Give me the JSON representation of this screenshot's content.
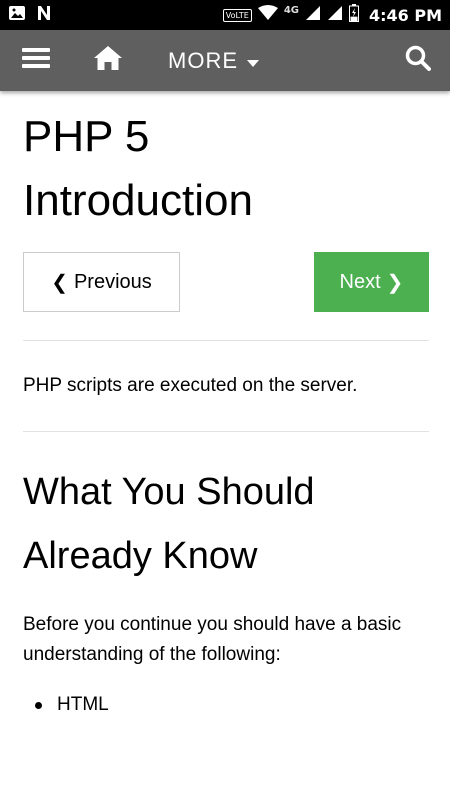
{
  "status_bar": {
    "volte": "VoLTE",
    "network": "4G",
    "battery_level": 0.3,
    "time": "4:46 PM"
  },
  "navbar": {
    "more_label": "MORE"
  },
  "content": {
    "title_line1": "PHP 5",
    "title_line2": "Introduction",
    "prev_label": "Previous",
    "next_label": "Next",
    "intro": "PHP scripts are executed on the server.",
    "section_title_line1": "What You Should",
    "section_title_line2": "Already Know",
    "paragraph": "Before you continue you should have a basic understanding of the following:",
    "list_items": [
      "HTML"
    ]
  },
  "colors": {
    "navbar_bg": "#5f5f5f",
    "next_button_bg": "#4CAF50",
    "status_bar_bg": "#000000"
  }
}
